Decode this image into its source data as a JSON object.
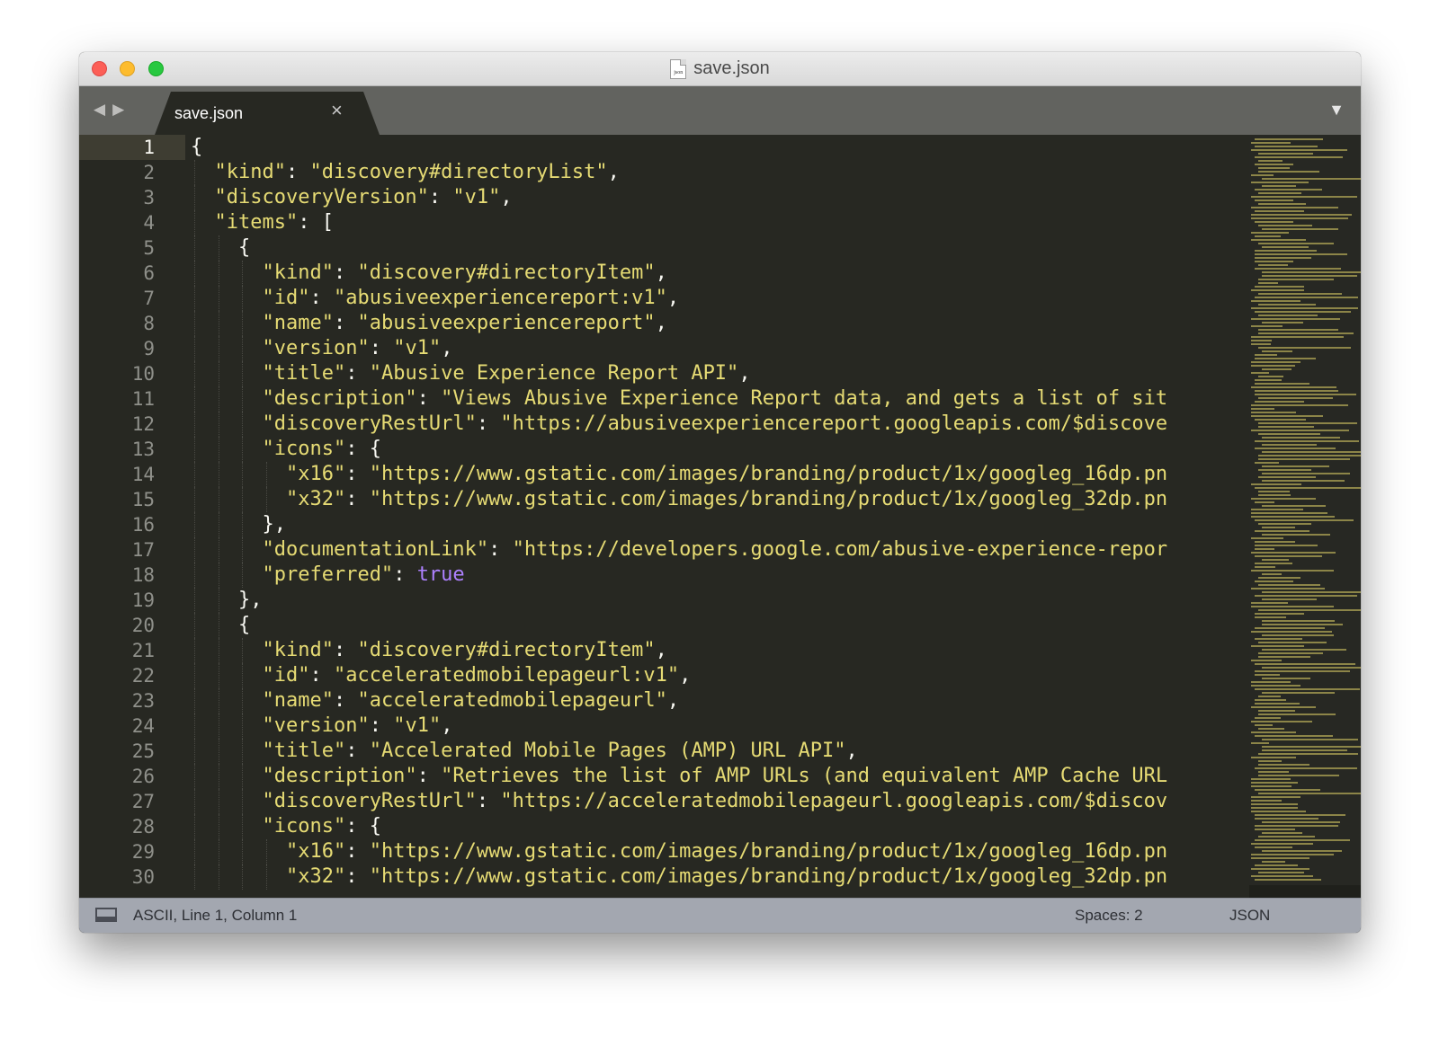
{
  "window": {
    "title": "save.json",
    "file_icon_text": "json"
  },
  "tabbar": {
    "nav_back": "◀",
    "nav_forward": "▶",
    "tabs": [
      {
        "label": "save.json",
        "close_glyph": "×"
      }
    ],
    "menu_glyph": "▼"
  },
  "editor": {
    "active_line": 1,
    "lines": [
      [
        {
          "t": "p",
          "v": "{"
        }
      ],
      [
        {
          "t": "p",
          "v": "  "
        },
        {
          "t": "k",
          "v": "\"kind\""
        },
        {
          "t": "p",
          "v": ": "
        },
        {
          "t": "s",
          "v": "\"discovery#directoryList\""
        },
        {
          "t": "p",
          "v": ","
        }
      ],
      [
        {
          "t": "p",
          "v": "  "
        },
        {
          "t": "k",
          "v": "\"discoveryVersion\""
        },
        {
          "t": "p",
          "v": ": "
        },
        {
          "t": "s",
          "v": "\"v1\""
        },
        {
          "t": "p",
          "v": ","
        }
      ],
      [
        {
          "t": "p",
          "v": "  "
        },
        {
          "t": "k",
          "v": "\"items\""
        },
        {
          "t": "p",
          "v": ": ["
        }
      ],
      [
        {
          "t": "p",
          "v": "    {"
        }
      ],
      [
        {
          "t": "p",
          "v": "      "
        },
        {
          "t": "k",
          "v": "\"kind\""
        },
        {
          "t": "p",
          "v": ": "
        },
        {
          "t": "s",
          "v": "\"discovery#directoryItem\""
        },
        {
          "t": "p",
          "v": ","
        }
      ],
      [
        {
          "t": "p",
          "v": "      "
        },
        {
          "t": "k",
          "v": "\"id\""
        },
        {
          "t": "p",
          "v": ": "
        },
        {
          "t": "s",
          "v": "\"abusiveexperiencereport:v1\""
        },
        {
          "t": "p",
          "v": ","
        }
      ],
      [
        {
          "t": "p",
          "v": "      "
        },
        {
          "t": "k",
          "v": "\"name\""
        },
        {
          "t": "p",
          "v": ": "
        },
        {
          "t": "s",
          "v": "\"abusiveexperiencereport\""
        },
        {
          "t": "p",
          "v": ","
        }
      ],
      [
        {
          "t": "p",
          "v": "      "
        },
        {
          "t": "k",
          "v": "\"version\""
        },
        {
          "t": "p",
          "v": ": "
        },
        {
          "t": "s",
          "v": "\"v1\""
        },
        {
          "t": "p",
          "v": ","
        }
      ],
      [
        {
          "t": "p",
          "v": "      "
        },
        {
          "t": "k",
          "v": "\"title\""
        },
        {
          "t": "p",
          "v": ": "
        },
        {
          "t": "s",
          "v": "\"Abusive Experience Report API\""
        },
        {
          "t": "p",
          "v": ","
        }
      ],
      [
        {
          "t": "p",
          "v": "      "
        },
        {
          "t": "k",
          "v": "\"description\""
        },
        {
          "t": "p",
          "v": ": "
        },
        {
          "t": "s",
          "v": "\"Views Abusive Experience Report data, and gets a list of sit"
        }
      ],
      [
        {
          "t": "p",
          "v": "      "
        },
        {
          "t": "k",
          "v": "\"discoveryRestUrl\""
        },
        {
          "t": "p",
          "v": ": "
        },
        {
          "t": "s",
          "v": "\"https://abusiveexperiencereport.googleapis.com/$discove"
        }
      ],
      [
        {
          "t": "p",
          "v": "      "
        },
        {
          "t": "k",
          "v": "\"icons\""
        },
        {
          "t": "p",
          "v": ": {"
        }
      ],
      [
        {
          "t": "p",
          "v": "        "
        },
        {
          "t": "k",
          "v": "\"x16\""
        },
        {
          "t": "p",
          "v": ": "
        },
        {
          "t": "s",
          "v": "\"https://www.gstatic.com/images/branding/product/1x/googleg_16dp.pn"
        }
      ],
      [
        {
          "t": "p",
          "v": "        "
        },
        {
          "t": "k",
          "v": "\"x32\""
        },
        {
          "t": "p",
          "v": ": "
        },
        {
          "t": "s",
          "v": "\"https://www.gstatic.com/images/branding/product/1x/googleg_32dp.pn"
        }
      ],
      [
        {
          "t": "p",
          "v": "      },"
        }
      ],
      [
        {
          "t": "p",
          "v": "      "
        },
        {
          "t": "k",
          "v": "\"documentationLink\""
        },
        {
          "t": "p",
          "v": ": "
        },
        {
          "t": "s",
          "v": "\"https://developers.google.com/abusive-experience-repor"
        }
      ],
      [
        {
          "t": "p",
          "v": "      "
        },
        {
          "t": "k",
          "v": "\"preferred\""
        },
        {
          "t": "p",
          "v": ": "
        },
        {
          "t": "b",
          "v": "true"
        }
      ],
      [
        {
          "t": "p",
          "v": "    },"
        }
      ],
      [
        {
          "t": "p",
          "v": "    {"
        }
      ],
      [
        {
          "t": "p",
          "v": "      "
        },
        {
          "t": "k",
          "v": "\"kind\""
        },
        {
          "t": "p",
          "v": ": "
        },
        {
          "t": "s",
          "v": "\"discovery#directoryItem\""
        },
        {
          "t": "p",
          "v": ","
        }
      ],
      [
        {
          "t": "p",
          "v": "      "
        },
        {
          "t": "k",
          "v": "\"id\""
        },
        {
          "t": "p",
          "v": ": "
        },
        {
          "t": "s",
          "v": "\"acceleratedmobilepageurl:v1\""
        },
        {
          "t": "p",
          "v": ","
        }
      ],
      [
        {
          "t": "p",
          "v": "      "
        },
        {
          "t": "k",
          "v": "\"name\""
        },
        {
          "t": "p",
          "v": ": "
        },
        {
          "t": "s",
          "v": "\"acceleratedmobilepageurl\""
        },
        {
          "t": "p",
          "v": ","
        }
      ],
      [
        {
          "t": "p",
          "v": "      "
        },
        {
          "t": "k",
          "v": "\"version\""
        },
        {
          "t": "p",
          "v": ": "
        },
        {
          "t": "s",
          "v": "\"v1\""
        },
        {
          "t": "p",
          "v": ","
        }
      ],
      [
        {
          "t": "p",
          "v": "      "
        },
        {
          "t": "k",
          "v": "\"title\""
        },
        {
          "t": "p",
          "v": ": "
        },
        {
          "t": "s",
          "v": "\"Accelerated Mobile Pages (AMP) URL API\""
        },
        {
          "t": "p",
          "v": ","
        }
      ],
      [
        {
          "t": "p",
          "v": "      "
        },
        {
          "t": "k",
          "v": "\"description\""
        },
        {
          "t": "p",
          "v": ": "
        },
        {
          "t": "s",
          "v": "\"Retrieves the list of AMP URLs (and equivalent AMP Cache URL"
        }
      ],
      [
        {
          "t": "p",
          "v": "      "
        },
        {
          "t": "k",
          "v": "\"discoveryRestUrl\""
        },
        {
          "t": "p",
          "v": ": "
        },
        {
          "t": "s",
          "v": "\"https://acceleratedmobilepageurl.googleapis.com/$discov"
        }
      ],
      [
        {
          "t": "p",
          "v": "      "
        },
        {
          "t": "k",
          "v": "\"icons\""
        },
        {
          "t": "p",
          "v": ": {"
        }
      ],
      [
        {
          "t": "p",
          "v": "        "
        },
        {
          "t": "k",
          "v": "\"x16\""
        },
        {
          "t": "p",
          "v": ": "
        },
        {
          "t": "s",
          "v": "\"https://www.gstatic.com/images/branding/product/1x/googleg_16dp.pn"
        }
      ],
      [
        {
          "t": "p",
          "v": "        "
        },
        {
          "t": "k",
          "v": "\"x32\""
        },
        {
          "t": "p",
          "v": ": "
        },
        {
          "t": "s",
          "v": "\"https://www.gstatic.com/images/branding/product/1x/googleg_32dp.pn"
        }
      ]
    ]
  },
  "statusbar": {
    "position": "ASCII, Line 1, Column 1",
    "indentation": "Spaces: 2",
    "syntax": "JSON"
  },
  "colors": {
    "background": "#272822",
    "string": "#e6db74",
    "boolean": "#ae81ff",
    "punctuation": "#f8f8f2",
    "line_number": "#8f908a"
  }
}
